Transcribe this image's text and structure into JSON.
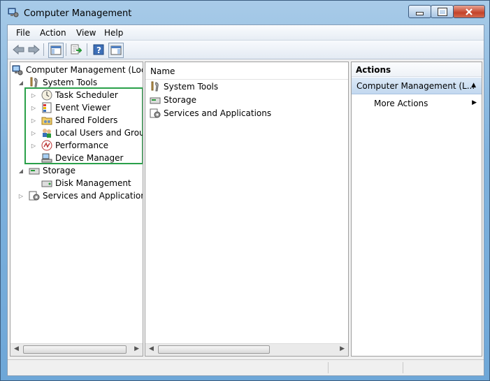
{
  "window": {
    "title": "Computer Management",
    "accent": "#2aa04a"
  },
  "menu": [
    "File",
    "Action",
    "View",
    "Help"
  ],
  "toolbar": [
    "back-icon",
    "forward-icon",
    "show-hide-console-tree-icon",
    "export-list-icon",
    "help-icon",
    "show-hide-action-pane-icon"
  ],
  "tree": {
    "root": "Computer Management (Local",
    "system_tools": "System Tools",
    "items": [
      {
        "label": "Task Scheduler",
        "icon": "clock-icon"
      },
      {
        "label": "Event Viewer",
        "icon": "event-viewer-icon"
      },
      {
        "label": "Shared Folders",
        "icon": "shared-folder-icon"
      },
      {
        "label": "Local Users and Groups",
        "icon": "users-icon"
      },
      {
        "label": "Performance",
        "icon": "performance-icon"
      },
      {
        "label": "Device Manager",
        "icon": "device-manager-icon"
      }
    ],
    "storage": "Storage",
    "disk_management": "Disk Management",
    "services": "Services and Applications"
  },
  "list": {
    "header": "Name",
    "rows": [
      "System Tools",
      "Storage",
      "Services and Applications"
    ]
  },
  "actions": {
    "header": "Actions",
    "selected": "Computer Management (L...",
    "more": "More Actions"
  }
}
